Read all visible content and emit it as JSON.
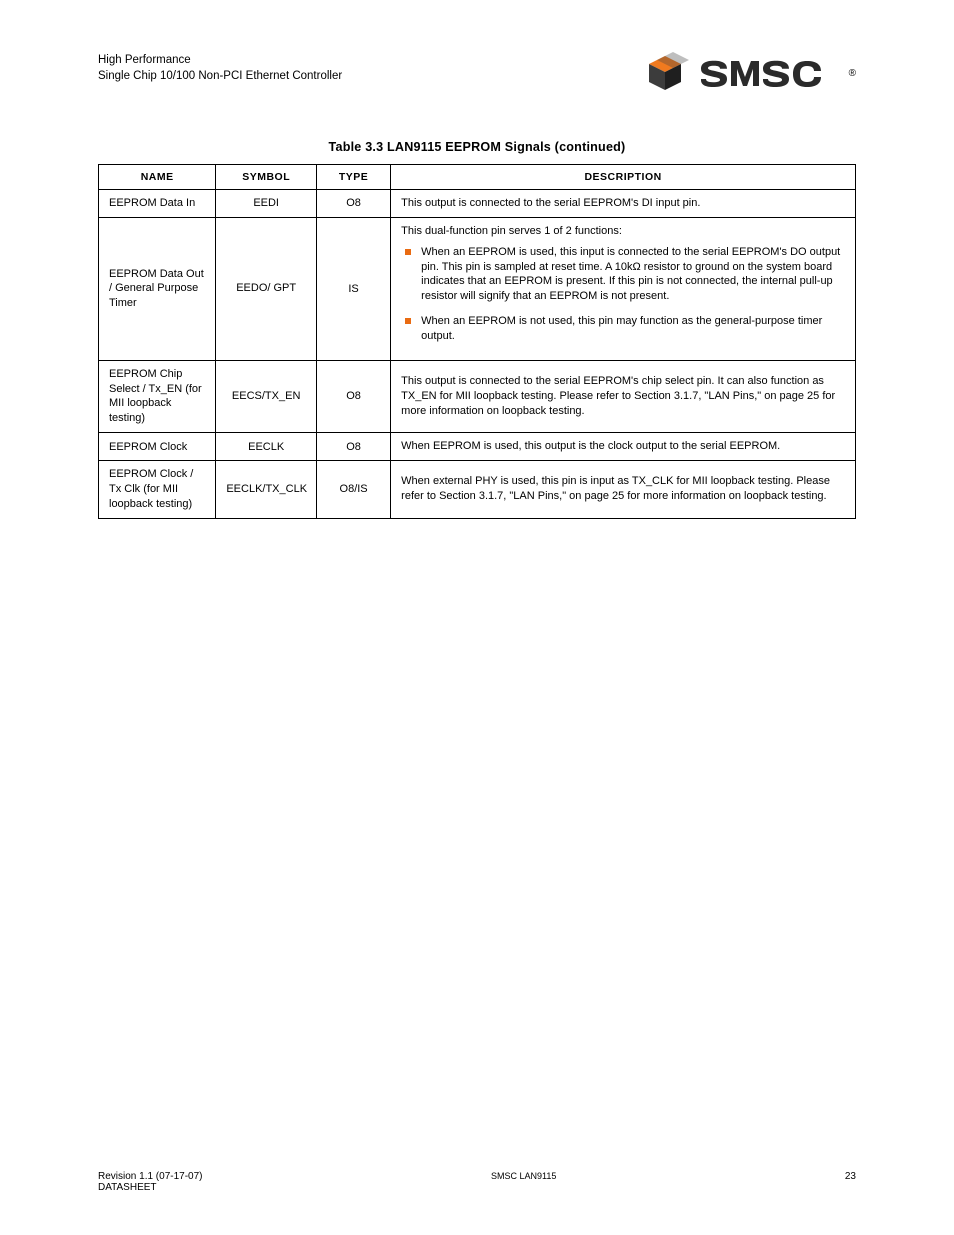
{
  "header": {
    "line1": "High Performance",
    "line2": "Single Chip 10/100 Non-PCI Ethernet Controller",
    "logo_text": "SMSC",
    "reg": "®"
  },
  "caption": "Table 3.3 LAN9115 EEPROM Signals (continued)",
  "columns": [
    "NAME",
    "SYMBOL",
    "TYPE",
    "DESCRIPTION"
  ],
  "rows": [
    {
      "name": "EEPROM Data In",
      "symbol": "EEDI",
      "type": "O8",
      "desc": "This output is connected to the serial EEPROM's DI input pin."
    },
    {
      "name": "EEPROM Data Out / General Purpose Timer",
      "symbol": "EEDO/ GPT",
      "type": "IS",
      "desc": "This dual-function pin serves 1 of 2 functions:",
      "bullets": [
        "When an EEPROM is used, this input is connected to the serial EEPROM's DO output pin. This pin is sampled at reset time. A 10kΩ resistor to ground on the system board indicates that an EEPROM is present. If this pin is not connected, the internal pull-up resistor will signify that an EEPROM is not present.",
        "When an EEPROM is not used, this pin may function as the general-purpose timer output."
      ]
    },
    {
      "name": "EEPROM Chip Select / Tx_EN (for MII loopback testing)",
      "symbol": "EECS/TX_EN",
      "type": "O8",
      "desc": "This output is connected to the serial EEPROM's chip select pin. It can also function as TX_EN for MII loopback testing. Please refer to Section 3.1.7, \"LAN Pins,\" on page 25 for more information on loopback testing."
    },
    {
      "name": "EEPROM Clock",
      "symbol": "EECLK",
      "type": "O8",
      "desc": "When EEPROM is used, this output is the clock output to the serial EEPROM."
    },
    {
      "name": "EEPROM Clock / Tx Clk (for MII loopback testing)",
      "symbol": "EECLK/TX_CLK",
      "type": "O8/IS",
      "desc": "When external PHY is used, this pin is input as TX_CLK for MII loopback testing. Please refer to Section 3.1.7, \"LAN Pins,\" on page 25 for more information on loopback testing."
    }
  ],
  "footer": {
    "left_top": "Revision 1.1 (07-17-07)",
    "left_bottom": "DATASHEET",
    "mid": "SMSC LAN9115",
    "right": "23"
  }
}
